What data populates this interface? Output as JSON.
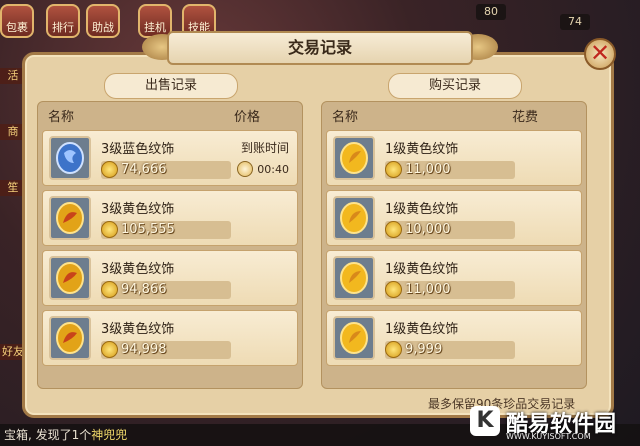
{
  "hud": {
    "top_buttons": [
      "包裹",
      "排行",
      "助战",
      "挂机",
      "技能"
    ],
    "counters": [
      "80",
      "74"
    ]
  },
  "side_tags": [
    "活",
    "商",
    "笙",
    "好友"
  ],
  "dialog": {
    "title": "交易记录",
    "close_icon": "close-icon",
    "sell": {
      "label": "出售记录",
      "col_name": "名称",
      "col_price": "价格",
      "items": [
        {
          "name": "3级蓝色纹饰",
          "price": "74,666",
          "icon": "blue-ornament-icon",
          "status_label": "到账时间",
          "status_time": "00:40"
        },
        {
          "name": "3级黄色纹饰",
          "price": "105,555",
          "icon": "gold-ornament-icon"
        },
        {
          "name": "3级黄色纹饰",
          "price": "94,866",
          "icon": "gold-ornament-icon"
        },
        {
          "name": "3级黄色纹饰",
          "price": "94,998",
          "icon": "gold-ornament-icon"
        }
      ]
    },
    "buy": {
      "label": "购买记录",
      "col_name": "名称",
      "col_cost": "花费",
      "items": [
        {
          "name": "1级黄色纹饰",
          "price": "11,000",
          "icon": "gold-ornament-icon"
        },
        {
          "name": "1级黄色纹饰",
          "price": "10,000",
          "icon": "gold-ornament-icon"
        },
        {
          "name": "1级黄色纹饰",
          "price": "11,000",
          "icon": "gold-ornament-icon"
        },
        {
          "name": "1级黄色纹饰",
          "price": "9,999",
          "icon": "gold-ornament-icon"
        }
      ]
    },
    "footer_note": "最多保留90条珍品交易记录"
  },
  "chat": {
    "text": "宝箱, 发现了1个",
    "highlight": "神兜兜"
  },
  "watermark": {
    "logo_letter": "K",
    "text": "酷易软件园",
    "url": "WWW.KUYISOFT.COM"
  },
  "colors": {
    "panel_bg": "#e6d0a6",
    "item_bg": "#f8ecd3",
    "coin": "#d49a18",
    "close": "#c0281f"
  }
}
